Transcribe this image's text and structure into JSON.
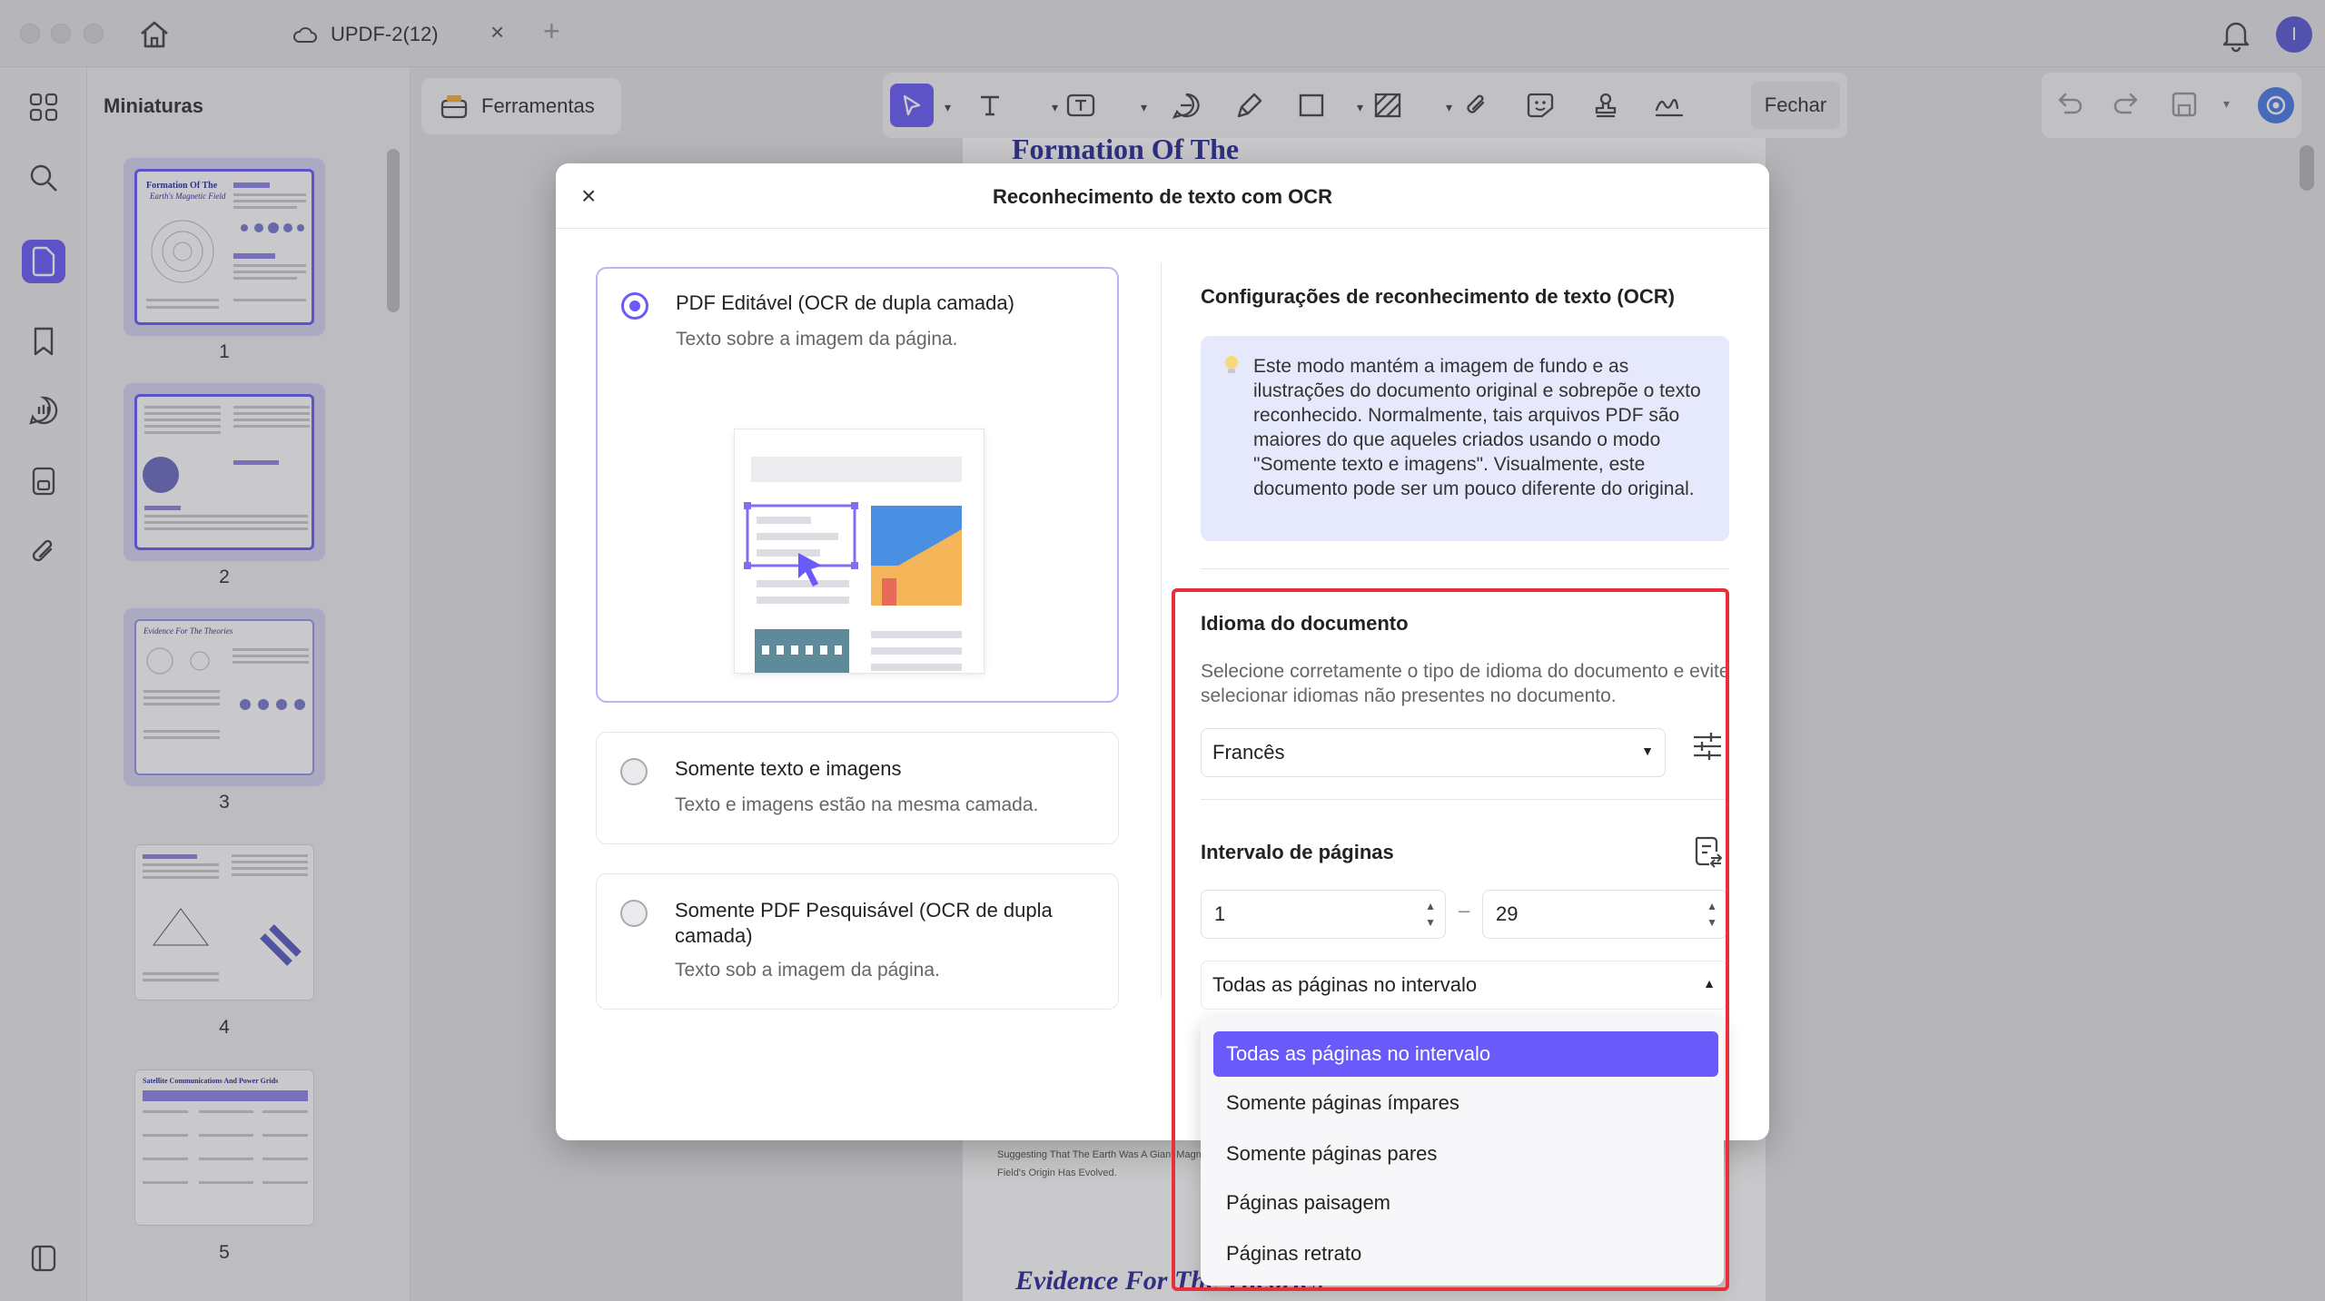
{
  "tab": {
    "title": "UPDF-2(12)",
    "close": "×",
    "add": "+"
  },
  "avatar_initial": "I",
  "thumbnails": {
    "title": "Miniaturas",
    "pages": [
      "1",
      "2",
      "3",
      "4",
      "5"
    ]
  },
  "toolbar": {
    "tools_label": "Ferramentas",
    "close_label": "Fechar"
  },
  "document": {
    "heading_top": "Formation Of The",
    "caption_lines": [
      "Suggesting That The Earth Was A Giant Magnet.",
      "Field's Origin Has Evolved."
    ],
    "heading_bottom": "Evidence For The Theories"
  },
  "modal": {
    "title": "Reconhecimento de texto com OCR",
    "close": "×",
    "options": [
      {
        "title": "PDF Editável (OCR de dupla camada)",
        "desc": "Texto sobre a imagem da página."
      },
      {
        "title": "Somente texto e imagens",
        "desc": "Texto e imagens estão na mesma camada."
      },
      {
        "title": "Somente PDF Pesquisável (OCR de dupla camada)",
        "desc": "Texto sob a imagem da página."
      }
    ],
    "settings_title": "Configurações de reconhecimento de texto (OCR)",
    "info": "Este modo mantém a imagem de fundo e as ilustrações do documento original e sobrepõe o texto reconhecido. Normalmente, tais arquivos PDF são maiores do que aqueles criados usando o modo \"Somente texto e imagens\". Visualmente, este documento pode ser um pouco diferente do original.",
    "language_title": "Idioma do documento",
    "language_desc": "Selecione corretamente o tipo de idioma do documento e evite selecionar idiomas não presentes no documento.",
    "language_value": "Francês",
    "range_title": "Intervalo de páginas",
    "range_from": "1",
    "range_to": "29",
    "range_dash": "–",
    "range_mode": "Todas as páginas no intervalo",
    "range_options": [
      "Todas as páginas no intervalo",
      "Somente páginas ímpares",
      "Somente páginas pares",
      "Páginas paisagem",
      "Páginas retrato"
    ]
  },
  "colors": {
    "accent": "#6a5af9",
    "highlight": "#e8303a",
    "info_bg": "#e6e9fb"
  }
}
